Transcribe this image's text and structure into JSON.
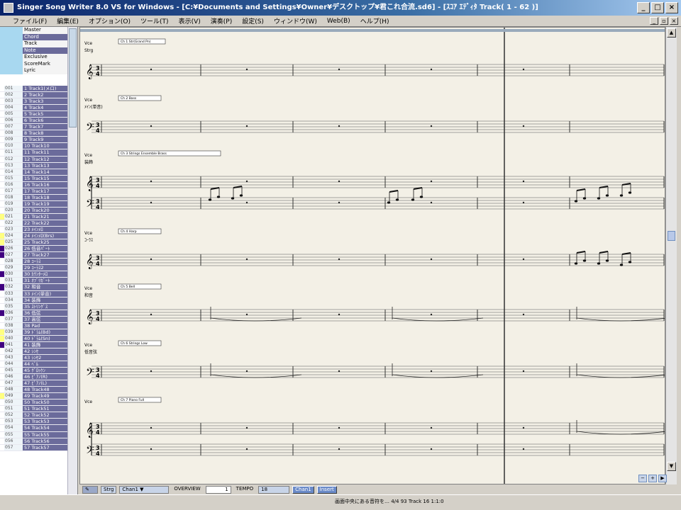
{
  "window": {
    "title": "Singer Song Writer 8.0 VS for Windows - [C:¥Documents and Settings¥Owner¥デスクトップ¥君これ合流.sd6] - [ｽｺｱ ｴﾃﾞｨﾀ Track( 1 - 62 )]",
    "minimize": "_",
    "maximize": "□",
    "close": "×"
  },
  "menu": [
    "ファイル(F)",
    "編集(E)",
    "オプション(O)",
    "ツール(T)",
    "表示(V)",
    "演奏(P)",
    "設定(S)",
    "ウィンドウ(W)",
    "Web(B)",
    "ヘルプ(H)"
  ],
  "mdi": {
    "minimize": "_",
    "restore": "▫",
    "close": "×"
  },
  "views": [
    {
      "label": "Master",
      "selected": false
    },
    {
      "label": "Chord",
      "selected": true
    },
    {
      "label": "Track",
      "selected": false
    },
    {
      "label": "Note",
      "selected": true
    },
    {
      "label": "Exclusive",
      "selected": false
    },
    {
      "label": "ScoreMark",
      "selected": false
    },
    {
      "label": "Lyric",
      "selected": false
    }
  ],
  "tracks": [
    {
      "num": "001",
      "name": "1 Track1(メロ)",
      "color": "#ffffff"
    },
    {
      "num": "002",
      "name": "2 Track2",
      "color": "#ffffff"
    },
    {
      "num": "003",
      "name": "3 Track3",
      "color": "#ffffff"
    },
    {
      "num": "004",
      "name": "4 Track4",
      "color": "#ffffff"
    },
    {
      "num": "005",
      "name": "5 Track5",
      "color": "#ffffff"
    },
    {
      "num": "006",
      "name": "6 Track6",
      "color": "#ffffff"
    },
    {
      "num": "007",
      "name": "7 Track7",
      "color": "#ffffff"
    },
    {
      "num": "008",
      "name": "8 Track8",
      "color": "#ffffff"
    },
    {
      "num": "009",
      "name": "9 Track9",
      "color": "#ffffff"
    },
    {
      "num": "010",
      "name": "10 Track10",
      "color": "#ffffff"
    },
    {
      "num": "011",
      "name": "11 Track11",
      "color": "#ffffff"
    },
    {
      "num": "012",
      "name": "12 Track12",
      "color": "#ffffff"
    },
    {
      "num": "013",
      "name": "13 Track13",
      "color": "#ffffff"
    },
    {
      "num": "014",
      "name": "14 Track14",
      "color": "#ffffff"
    },
    {
      "num": "015",
      "name": "15 Track15",
      "color": "#ffffff"
    },
    {
      "num": "016",
      "name": "16 Track16",
      "color": "#ffffff"
    },
    {
      "num": "017",
      "name": "17 Track17",
      "color": "#ffffff"
    },
    {
      "num": "018",
      "name": "18 Track18",
      "color": "#ffffff"
    },
    {
      "num": "019",
      "name": "19 Track19",
      "color": "#ffffff"
    },
    {
      "num": "020",
      "name": "20 Track20",
      "color": "#ffffff"
    },
    {
      "num": "021",
      "name": "21 Track21",
      "color": "#ffff80"
    },
    {
      "num": "022",
      "name": "22 Track22",
      "color": "#ffffff"
    },
    {
      "num": "023",
      "name": "23 ﾒｲﾝﾒﾛ",
      "color": "#ffffff"
    },
    {
      "num": "024",
      "name": "24 ﾒｲﾝﾒﾛ(Brs)",
      "color": "#ffff80"
    },
    {
      "num": "025",
      "name": "25 Track25",
      "color": "#ffff80"
    },
    {
      "num": "026",
      "name": "26 低音ﾊﾟｰﾄ",
      "color": "#400080"
    },
    {
      "num": "027",
      "name": "27 Track27",
      "color": "#400080"
    },
    {
      "num": "028",
      "name": "28 ｺｰﾗｽ",
      "color": "#ffffff"
    },
    {
      "num": "029",
      "name": "29 ｺｰﾗｽ2",
      "color": "#ffffff"
    },
    {
      "num": "030",
      "name": "30 ｶｳﾝﾀｰﾒﾛ",
      "color": "#400080"
    },
    {
      "num": "031",
      "name": "31 ｵﾌﾞﾘｶﾞｰﾄ",
      "color": "#ffffff"
    },
    {
      "num": "032",
      "name": "32 和音",
      "color": "#400080"
    },
    {
      "num": "033",
      "name": "33 ﾒｲﾝ(単音)",
      "color": "#ffffff"
    },
    {
      "num": "034",
      "name": "34 装飾",
      "color": "#ffffff"
    },
    {
      "num": "035",
      "name": "35 ｽﾄﾘﾝｸﾞｽ",
      "color": "#ffffff"
    },
    {
      "num": "036",
      "name": "36 低弦",
      "color": "#400080"
    },
    {
      "num": "037",
      "name": "37 高弦",
      "color": "#ffffff"
    },
    {
      "num": "038",
      "name": "38 Pad",
      "color": "#ffffff"
    },
    {
      "num": "039",
      "name": "39 ﾄﾞﾗﾑ(Bd)",
      "color": "#ffff80"
    },
    {
      "num": "040",
      "name": "40 ﾄﾞﾗﾑ(Sn)",
      "color": "#ffff80"
    },
    {
      "num": "041",
      "name": "41 装飾",
      "color": "#400080"
    },
    {
      "num": "042",
      "name": "42 ｼﾝｾ",
      "color": "#ffffff"
    },
    {
      "num": "043",
      "name": "43 ｼﾝｾ2",
      "color": "#ffffff"
    },
    {
      "num": "044",
      "name": "44 ﾍﾞﾙ",
      "color": "#ffffff"
    },
    {
      "num": "045",
      "name": "45 ｸﾞﾛｯｹﾝ",
      "color": "#ffffff"
    },
    {
      "num": "046",
      "name": "46 ﾋﾟｱﾉ(R)",
      "color": "#ffffff"
    },
    {
      "num": "047",
      "name": "47 ﾋﾟｱﾉ(L)",
      "color": "#ffffff"
    },
    {
      "num": "048",
      "name": "48 Track48",
      "color": "#ffffff"
    },
    {
      "num": "049",
      "name": "49 Track49",
      "color": "#ffff80"
    },
    {
      "num": "050",
      "name": "50 Track50",
      "color": "#ffffff"
    },
    {
      "num": "051",
      "name": "51 Track51",
      "color": "#ffffff"
    },
    {
      "num": "052",
      "name": "52 Track52",
      "color": "#ffffff"
    },
    {
      "num": "053",
      "name": "53 Track53",
      "color": "#ffffff"
    },
    {
      "num": "054",
      "name": "54 Track54",
      "color": "#ffffff"
    },
    {
      "num": "055",
      "name": "55 Track55",
      "color": "#ffffff"
    },
    {
      "num": "056",
      "name": "56 Track56",
      "color": "#ffffff"
    },
    {
      "num": "057",
      "name": "57 Track57",
      "color": "#ffffff"
    }
  ],
  "systems": [
    {
      "ch": "Vce",
      "label": "Strg",
      "patch": "Ch 1 Str(Grand Pn)",
      "clef": "treble",
      "grand": false,
      "bank": "001"
    },
    {
      "ch": "Vce",
      "label": "ﾒｲﾝ(単音)",
      "patch": "Ch 2 Bass",
      "clef": "bass",
      "grand": false,
      "bank": ""
    },
    {
      "ch": "Vce",
      "label": "装飾",
      "patch": "Ch 3 Strings Ensemble Brass",
      "clef": "treble",
      "grand": true,
      "bank": ""
    },
    {
      "ch": "Vce",
      "label": "ｺｰﾗｽ",
      "patch": "Ch 4 Harp",
      "clef": "treble",
      "grand": false,
      "bank": ""
    },
    {
      "ch": "Vce",
      "label": "和音",
      "patch": "Ch 5 Bell",
      "clef": "treble",
      "grand": false,
      "bank": ""
    },
    {
      "ch": "Vce",
      "label": "低音弦",
      "patch": "Ch 6 Strings Low",
      "clef": "bass",
      "grand": false,
      "bank": ""
    },
    {
      "ch": "Vce",
      "label": "",
      "patch": "Ch 7 Piano Full",
      "clef": "treble",
      "grand": true,
      "bank": ""
    }
  ],
  "time_signature": {
    "num": "3",
    "den": "4"
  },
  "bottombar": {
    "mode": "Strg",
    "track_select": "Chan1",
    "zoom_label": "OVERVIEW",
    "zoom_value": "1",
    "tempo_label": "TEMPO",
    "tempo_value": "18",
    "btn1": "Chan1",
    "btn2": "Insert"
  },
  "status": "画面中央にある音符を…  4/4  93  Track 16  1:1:0"
}
